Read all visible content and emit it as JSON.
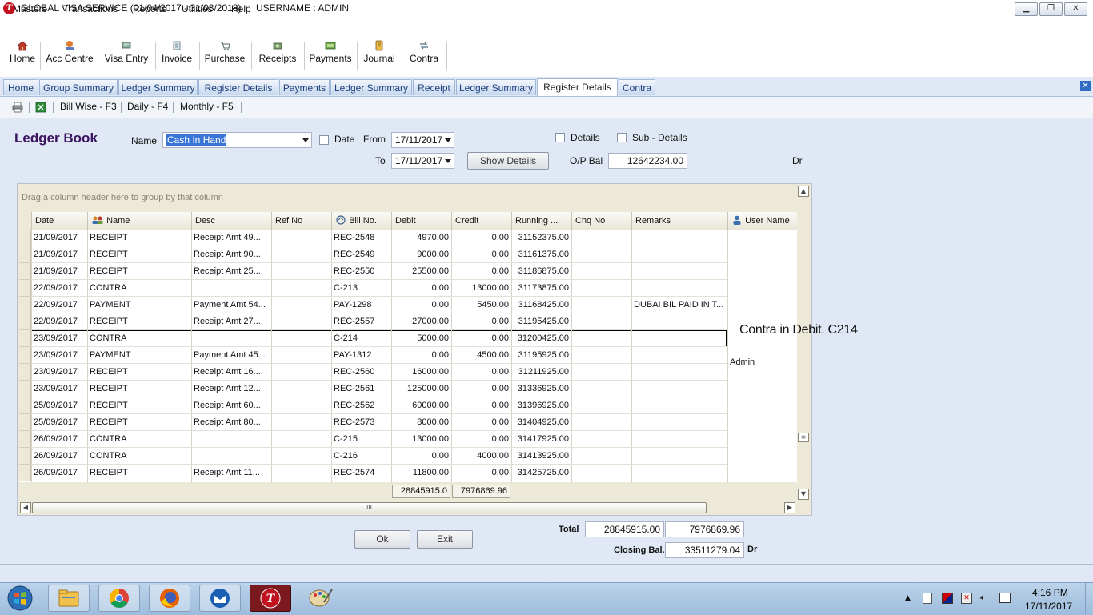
{
  "window": {
    "title": "GLOBAL VISA SERVICE (01/04/2017 - 31/03/2018)",
    "user": "USERNAME : ADMIN"
  },
  "menu": [
    "Masters",
    "Transactions",
    "Reports",
    "Utilities",
    "Help"
  ],
  "toolbar": [
    {
      "label": "Home",
      "icon": "home-icon"
    },
    {
      "label": "Acc Centre",
      "icon": "acc-centre-icon"
    },
    {
      "label": "Visa Entry",
      "icon": "visa-entry-icon"
    },
    {
      "label": "Invoice",
      "icon": "invoice-icon"
    },
    {
      "label": "Purchase",
      "icon": "purchase-icon"
    },
    {
      "label": "Receipts",
      "icon": "receipts-icon"
    },
    {
      "label": "Payments",
      "icon": "payments-icon"
    },
    {
      "label": "Journal",
      "icon": "journal-icon"
    },
    {
      "label": "Contra",
      "icon": "contra-icon"
    }
  ],
  "tabs": [
    "Home",
    "Group Summary",
    "Ledger Summary",
    "Register Details",
    "Payments",
    "Ledger Summary",
    "Receipt",
    "Ledger Summary",
    "Register Details",
    "Contra"
  ],
  "active_tab": 8,
  "subtoolbar": [
    "Bill Wise - F3",
    "Daily - F4",
    "Monthly - F5"
  ],
  "form": {
    "title": "Ledger Book",
    "name_label": "Name",
    "name_value": "Cash In Hand",
    "date_label": "Date",
    "from_label": "From",
    "from_value": "17/11/2017",
    "to_label": "To",
    "to_value": "17/11/2017",
    "details_label": "Details",
    "subdetails_label": "Sub - Details",
    "show_details_label": "Show Details",
    "opbal_label": "O/P Bal",
    "opbal_value": "12642234.00",
    "opbal_side": "Dr"
  },
  "grid": {
    "group_hint": "Drag a column header here to group by that column",
    "columns": [
      "Date",
      "Name",
      "Desc",
      "Ref No",
      "Bill No.",
      "Debit",
      "Credit",
      "Running ...",
      "Chq No",
      "Remarks",
      "User Name"
    ],
    "rows": [
      [
        "21/09/2017",
        "RECEIPT",
        "Receipt Amt 49...",
        "",
        "REC-2548",
        "4970.00",
        "0.00",
        "31152375.00",
        "",
        ""
      ],
      [
        "21/09/2017",
        "RECEIPT",
        "Receipt Amt 90...",
        "",
        "REC-2549",
        "9000.00",
        "0.00",
        "31161375.00",
        "",
        ""
      ],
      [
        "21/09/2017",
        "RECEIPT",
        "Receipt Amt 25...",
        "",
        "REC-2550",
        "25500.00",
        "0.00",
        "31186875.00",
        "",
        ""
      ],
      [
        "22/09/2017",
        "CONTRA",
        "",
        "",
        "C-213",
        "0.00",
        "13000.00",
        "31173875.00",
        "",
        ""
      ],
      [
        "22/09/2017",
        "PAYMENT",
        "Payment Amt 54...",
        "",
        "PAY-1298",
        "0.00",
        "5450.00",
        "31168425.00",
        "",
        "DUBAI BIL PAID IN T..."
      ],
      [
        "22/09/2017",
        "RECEIPT",
        "Receipt Amt 27...",
        "",
        "REC-2557",
        "27000.00",
        "0.00",
        "31195425.00",
        "",
        ""
      ],
      [
        "23/09/2017",
        "CONTRA",
        "",
        "",
        "C-214",
        "5000.00",
        "0.00",
        "31200425.00",
        "",
        ""
      ],
      [
        "23/09/2017",
        "PAYMENT",
        "Payment Amt 45...",
        "",
        "PAY-1312",
        "0.00",
        "4500.00",
        "31195925.00",
        "",
        ""
      ],
      [
        "23/09/2017",
        "RECEIPT",
        "Receipt Amt 16...",
        "",
        "REC-2560",
        "16000.00",
        "0.00",
        "31211925.00",
        "",
        ""
      ],
      [
        "23/09/2017",
        "RECEIPT",
        "Receipt Amt 12...",
        "",
        "REC-2561",
        "125000.00",
        "0.00",
        "31336925.00",
        "",
        ""
      ],
      [
        "25/09/2017",
        "RECEIPT",
        "Receipt Amt 60...",
        "",
        "REC-2562",
        "60000.00",
        "0.00",
        "31396925.00",
        "",
        ""
      ],
      [
        "25/09/2017",
        "RECEIPT",
        "Receipt Amt 80...",
        "",
        "REC-2573",
        "8000.00",
        "0.00",
        "31404925.00",
        "",
        ""
      ],
      [
        "26/09/2017",
        "CONTRA",
        "",
        "",
        "C-215",
        "13000.00",
        "0.00",
        "31417925.00",
        "",
        ""
      ],
      [
        "26/09/2017",
        "CONTRA",
        "",
        "",
        "C-216",
        "0.00",
        "4000.00",
        "31413925.00",
        "",
        ""
      ],
      [
        "26/09/2017",
        "RECEIPT",
        "Receipt Amt 11...",
        "",
        "REC-2574",
        "11800.00",
        "0.00",
        "31425725.00",
        "",
        ""
      ]
    ],
    "selected_row": 6,
    "user_name_value": "Admin",
    "footer_debit": "28845915.0",
    "footer_credit": "7976869.96",
    "hscroll_grip": "III"
  },
  "annotation": "Contra in Debit. C214",
  "buttons": {
    "ok": "Ok",
    "exit": "Exit"
  },
  "totals": {
    "total_label": "Total",
    "total_debit": "28845915.00",
    "total_credit": "7976869.96",
    "closing_label": "Closing Bal.",
    "closing_value": "33511279.04",
    "closing_side": "Dr"
  },
  "taskbar": {
    "apps": [
      "windows-start-icon",
      "file-explorer-icon",
      "chrome-icon",
      "firefox-icon",
      "thunderbird-icon",
      "visa-app-icon",
      "paint-icon"
    ],
    "time": "4:16 PM",
    "date": "17/11/2017"
  }
}
